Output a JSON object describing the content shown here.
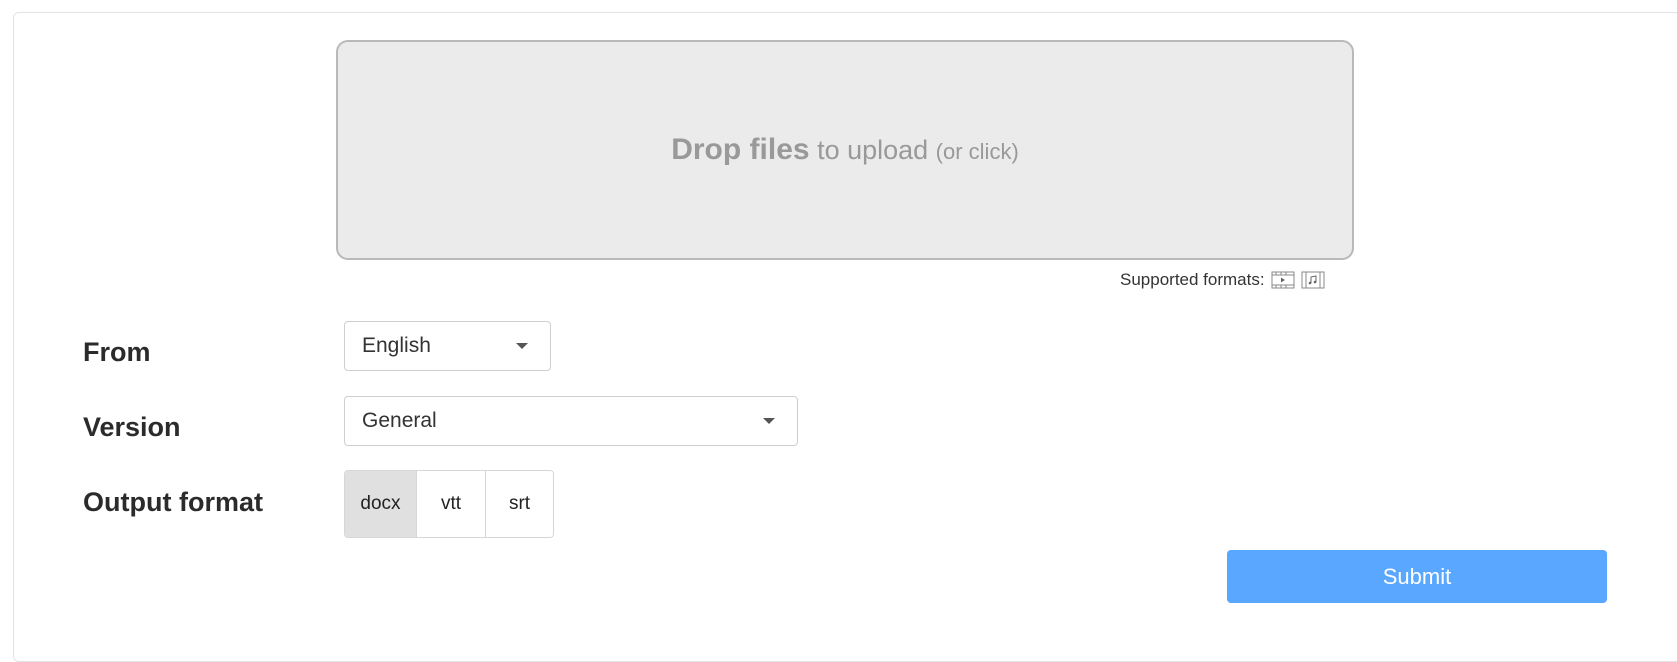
{
  "upload": {
    "strong": "Drop files",
    "normal": " to upload ",
    "small": "(or click)"
  },
  "supported": {
    "label": "Supported formats:",
    "icons": [
      "video-file-icon",
      "audio-file-icon"
    ]
  },
  "form": {
    "from": {
      "label": "From",
      "value": "English"
    },
    "version": {
      "label": "Version",
      "value": "General"
    },
    "output": {
      "label": "Output format",
      "options": [
        "docx",
        "vtt",
        "srt"
      ],
      "selected": "docx"
    }
  },
  "submit": {
    "label": "Submit"
  },
  "colors": {
    "accent": "#5aa7ff",
    "dropzone_bg": "#ebebeb",
    "selected_segment": "#e0e0e0"
  }
}
